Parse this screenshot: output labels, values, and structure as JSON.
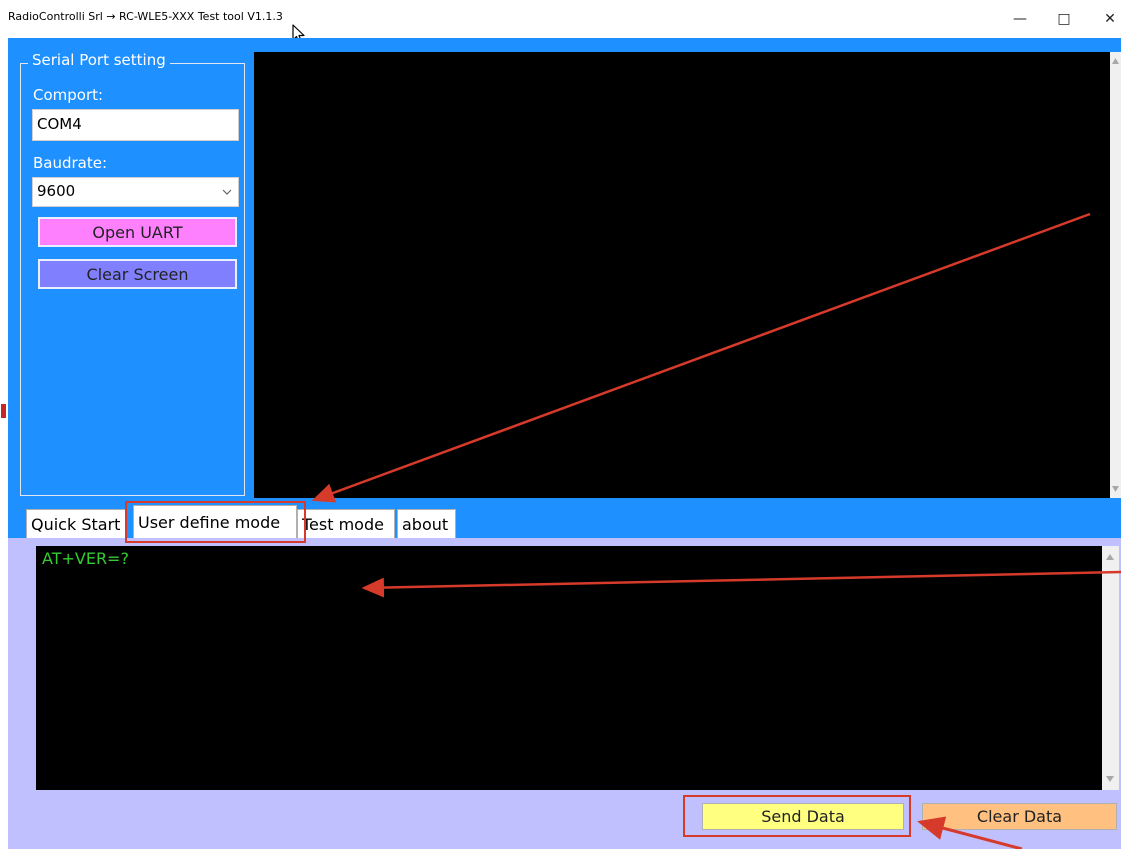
{
  "window": {
    "title": "RadioControlli Srl → RC-WLE5-XXX Test tool V1.1.3",
    "minimize_glyph": "—",
    "maximize_glyph": "□",
    "close_glyph": "✕"
  },
  "serial_settings": {
    "group_label": "Serial Port setting",
    "comport_label": "Comport:",
    "comport_value": "COM4",
    "baudrate_label": "Baudrate:",
    "baudrate_value": "9600",
    "open_uart_label": "Open UART",
    "clear_screen_label": "Clear Screen"
  },
  "tabs": [
    {
      "label": "Quick Start"
    },
    {
      "label": "User define mode"
    },
    {
      "label": "Test mode"
    },
    {
      "label": "about"
    }
  ],
  "active_tab": "User define mode",
  "user_define": {
    "command_text": "AT+VER=?",
    "send_label": "Send Data",
    "clear_label": "Clear Data"
  },
  "colors": {
    "panel_blue": "#1e90ff",
    "open_uart": "#ff80ff",
    "clear_screen": "#8080ff",
    "tab_panel": "#c0c0ff",
    "command_text": "#33cc33",
    "send_button": "#ffff80",
    "clear_button": "#ffc080",
    "annotation_red": "#d63a2a"
  },
  "icons": {
    "cursor": "mouse-pointer-icon",
    "dropdown": "chevron-down-icon",
    "scroll_up": "triangle-up-icon",
    "scroll_down": "triangle-down-icon"
  }
}
